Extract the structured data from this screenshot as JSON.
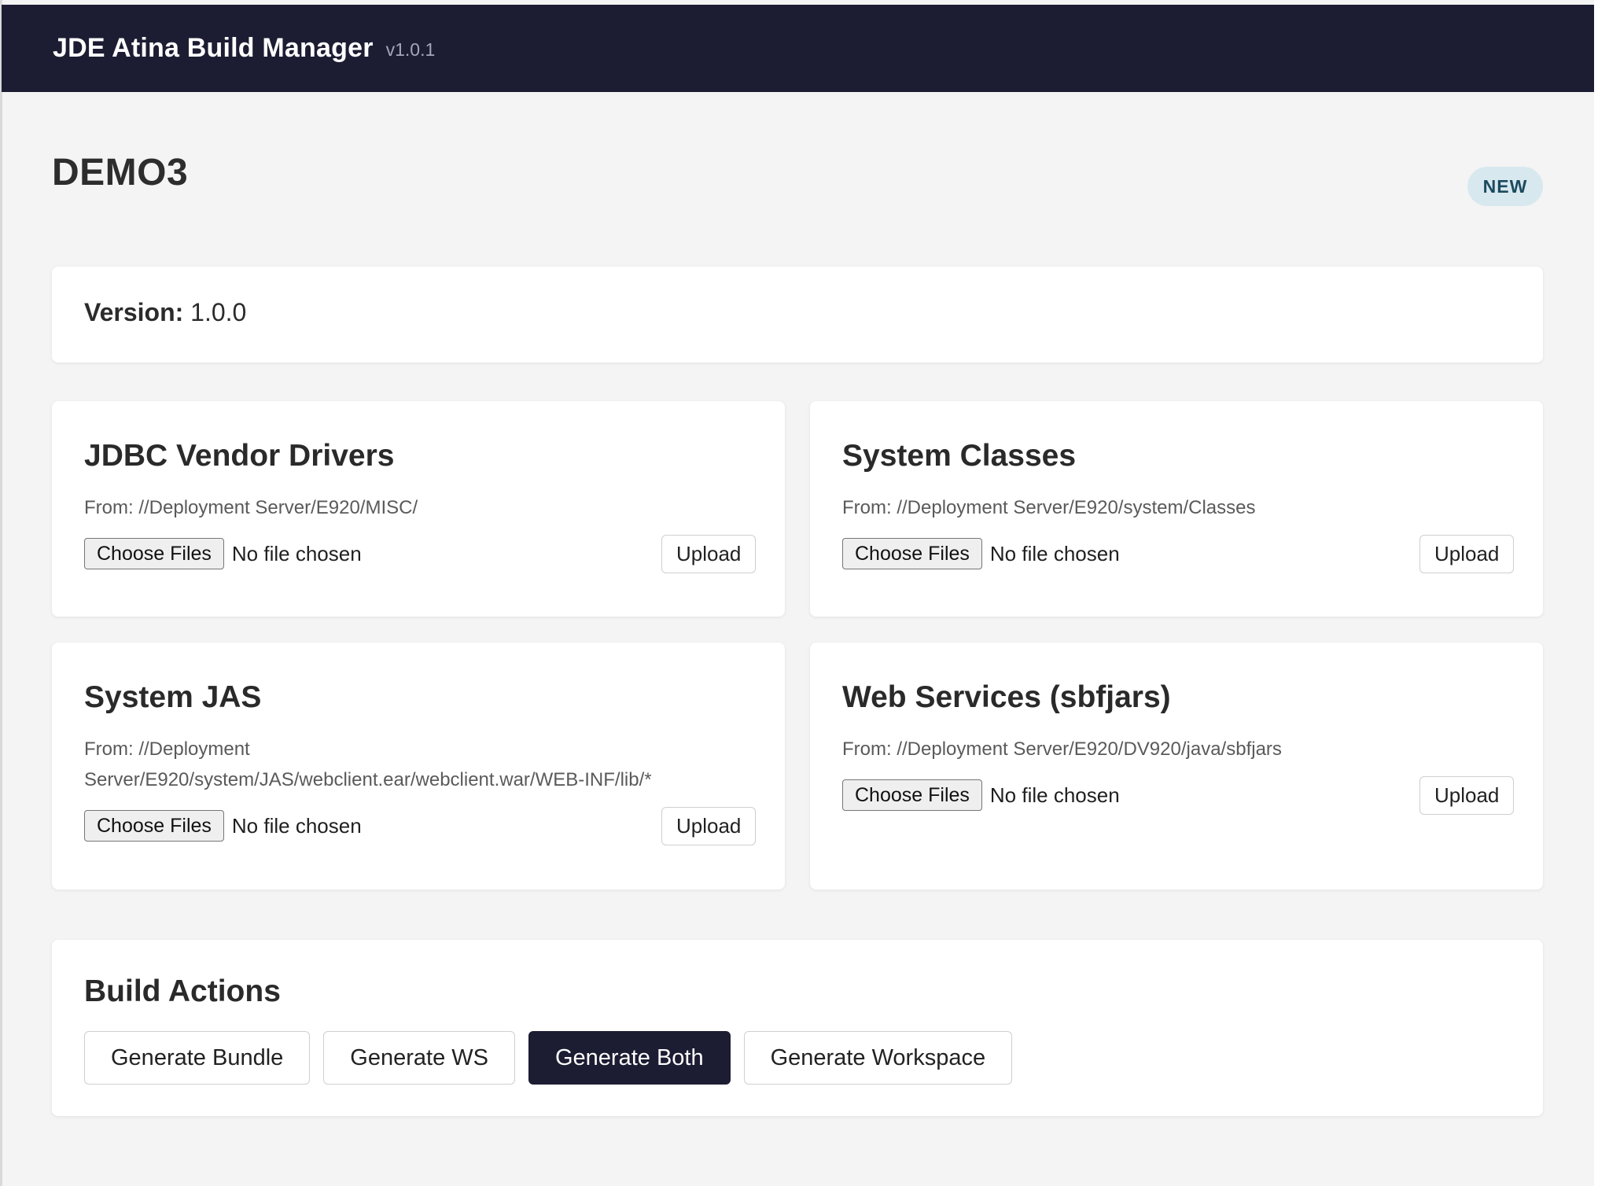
{
  "header": {
    "title": "JDE Atina Build Manager",
    "version": "v1.0.1"
  },
  "project": {
    "name": "DEMO3",
    "status": "NEW"
  },
  "version_info": {
    "label": "Version:",
    "value": "1.0.0"
  },
  "uploads": [
    {
      "title": "JDBC Vendor Drivers",
      "source_line1": "From: //Deployment Server/E920/MISC/",
      "source_line2": "",
      "choose_label": "Choose Files",
      "file_status": "No file chosen",
      "upload_label": "Upload"
    },
    {
      "title": "System Classes",
      "source_line1": "From: //Deployment Server/E920/system/Classes",
      "source_line2": "",
      "choose_label": "Choose Files",
      "file_status": "No file chosen",
      "upload_label": "Upload"
    },
    {
      "title": "System JAS",
      "source_line1": "From: //Deployment",
      "source_line2": "Server/E920/system/JAS/webclient.ear/webclient.war/WEB-INF/lib/*",
      "choose_label": "Choose Files",
      "file_status": "No file chosen",
      "upload_label": "Upload"
    },
    {
      "title": "Web Services (sbfjars)",
      "source_line1": "From: //Deployment Server/E920/DV920/java/sbfjars",
      "source_line2": "",
      "choose_label": "Choose Files",
      "file_status": "No file chosen",
      "upload_label": "Upload"
    }
  ],
  "build_actions": {
    "title": "Build Actions",
    "buttons": [
      "Generate Bundle",
      "Generate WS",
      "Generate Both",
      "Generate Workspace"
    ]
  },
  "colors": {
    "header_bg": "#1c1d33",
    "page_bg": "#f4f4f4",
    "badge_bg": "#d8e8ef",
    "badge_text": "#1c4a5f"
  }
}
